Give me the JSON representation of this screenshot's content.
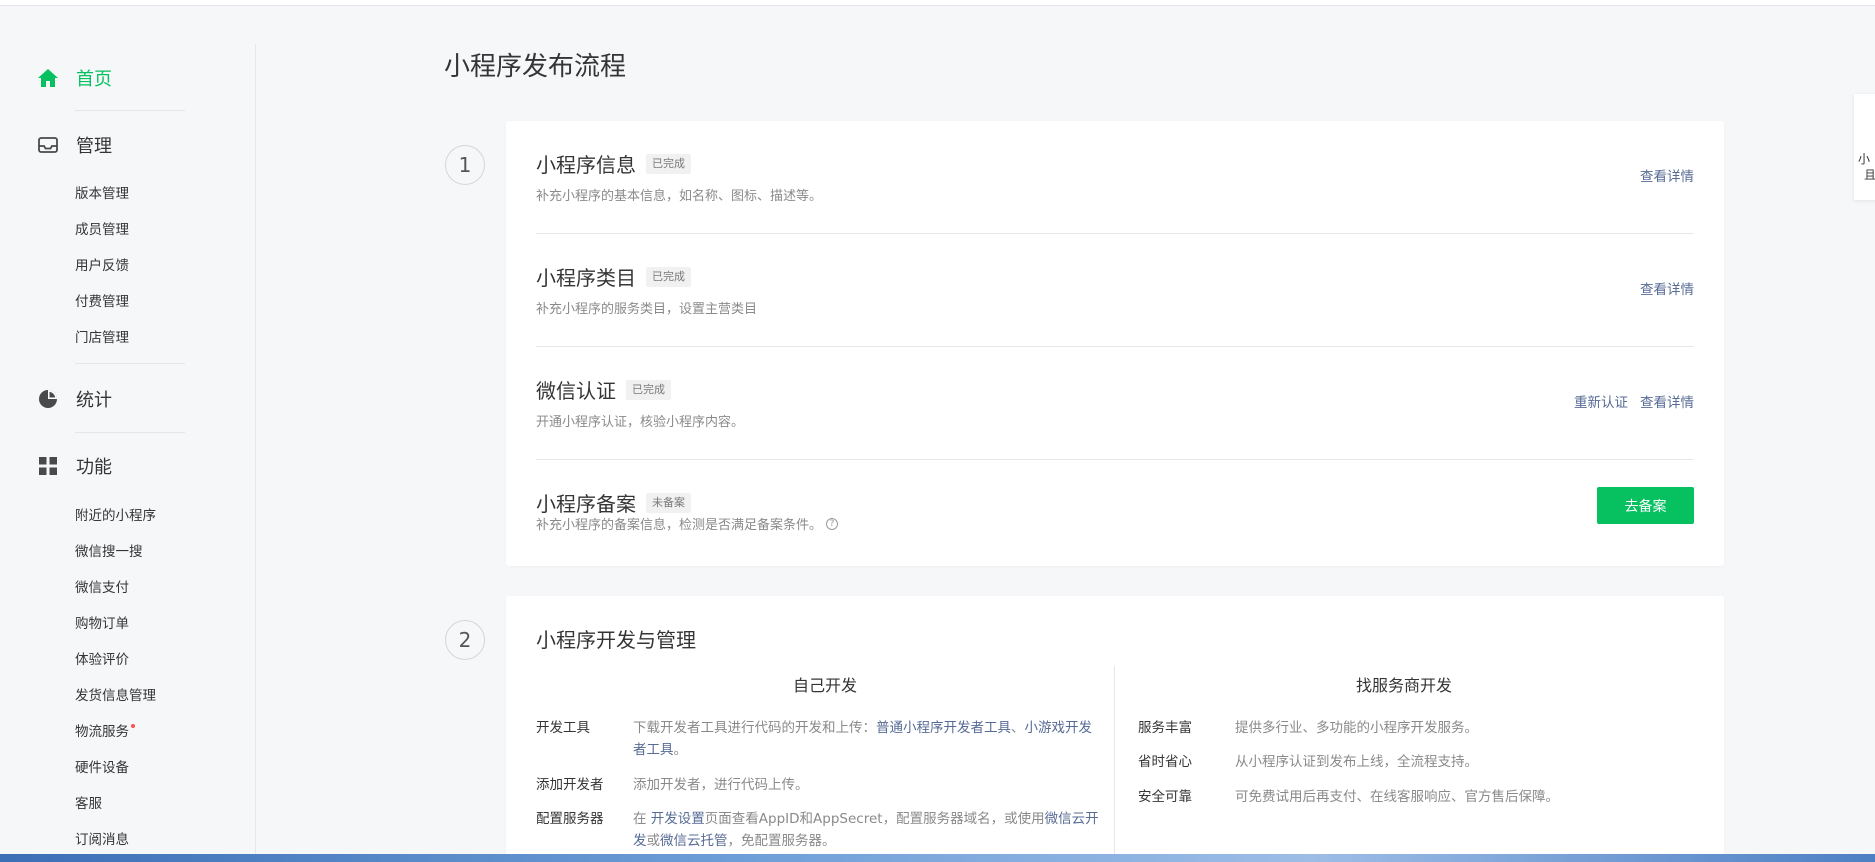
{
  "sidebar": {
    "home": {
      "label": "首页",
      "icon": "home-icon"
    },
    "manage": {
      "label": "管理",
      "icon": "inbox-icon"
    },
    "manage_items": [
      "版本管理",
      "成员管理",
      "用户反馈",
      "付费管理",
      "门店管理"
    ],
    "stats": {
      "label": "统计",
      "icon": "pie-chart-icon"
    },
    "features": {
      "label": "功能",
      "icon": "grid-icon"
    },
    "feature_items": [
      "附近的小程序",
      "微信搜一搜",
      "微信支付",
      "购物订单",
      "体验评价",
      "发货信息管理",
      "物流服务",
      "硬件设备",
      "客服",
      "订阅消息"
    ]
  },
  "page": {
    "title": "小程序发布流程"
  },
  "step1": {
    "number": "1",
    "rows": [
      {
        "title": "小程序信息",
        "tag": "已完成",
        "desc": "补充小程序的基本信息，如名称、图标、描述等。",
        "actions": [
          "查看详情"
        ]
      },
      {
        "title": "小程序类目",
        "tag": "已完成",
        "desc": "补充小程序的服务类目，设置主营类目",
        "actions": [
          "查看详情"
        ]
      },
      {
        "title": "微信认证",
        "tag": "已完成",
        "desc": "开通小程序认证，核验小程序内容。",
        "actions": [
          "重新认证",
          "查看详情"
        ]
      },
      {
        "title": "小程序备案",
        "tag": "未备案",
        "desc": "补充小程序的备案信息，检测是否满足备案条件。",
        "button": "去备案"
      }
    ]
  },
  "step2": {
    "number": "2",
    "title": "小程序开发与管理",
    "self_dev": {
      "heading": "自己开发",
      "items": [
        {
          "key": "开发工具",
          "text_a": "下载开发者工具进行代码的开发和上传：",
          "link_a": "普通小程序开发者工具",
          "sep": "、",
          "link_b": "小游戏开发者工具",
          "tail": "。"
        },
        {
          "key": "添加开发者",
          "text_a": "添加开发者，进行代码上传。"
        },
        {
          "key": "配置服务器",
          "text_a": "在 ",
          "link_a": "开发设置",
          "text_b": "页面查看AppID和AppSecret，配置服务器域名，或使用",
          "link_b": "微信云开发",
          "sep": "或",
          "link_c": "微信云托管",
          "tail": "，免配置服务器。"
        }
      ]
    },
    "vendor_dev": {
      "heading": "找服务商开发",
      "items": [
        {
          "key": "服务丰富",
          "text": "提供多行业、多功能的小程序开发服务。"
        },
        {
          "key": "省时省心",
          "text": "从小程序认证到发布上线，全流程支持。"
        },
        {
          "key": "安全可靠",
          "text": "可免费试用后再支付、在线客服响应、官方售后保障。"
        }
      ]
    }
  },
  "float_panel": {
    "line1": "小",
    "line2": "且"
  },
  "colors": {
    "accent": "#07c160",
    "link": "#576b95",
    "text": "#353535",
    "muted": "#8a8a8a"
  }
}
